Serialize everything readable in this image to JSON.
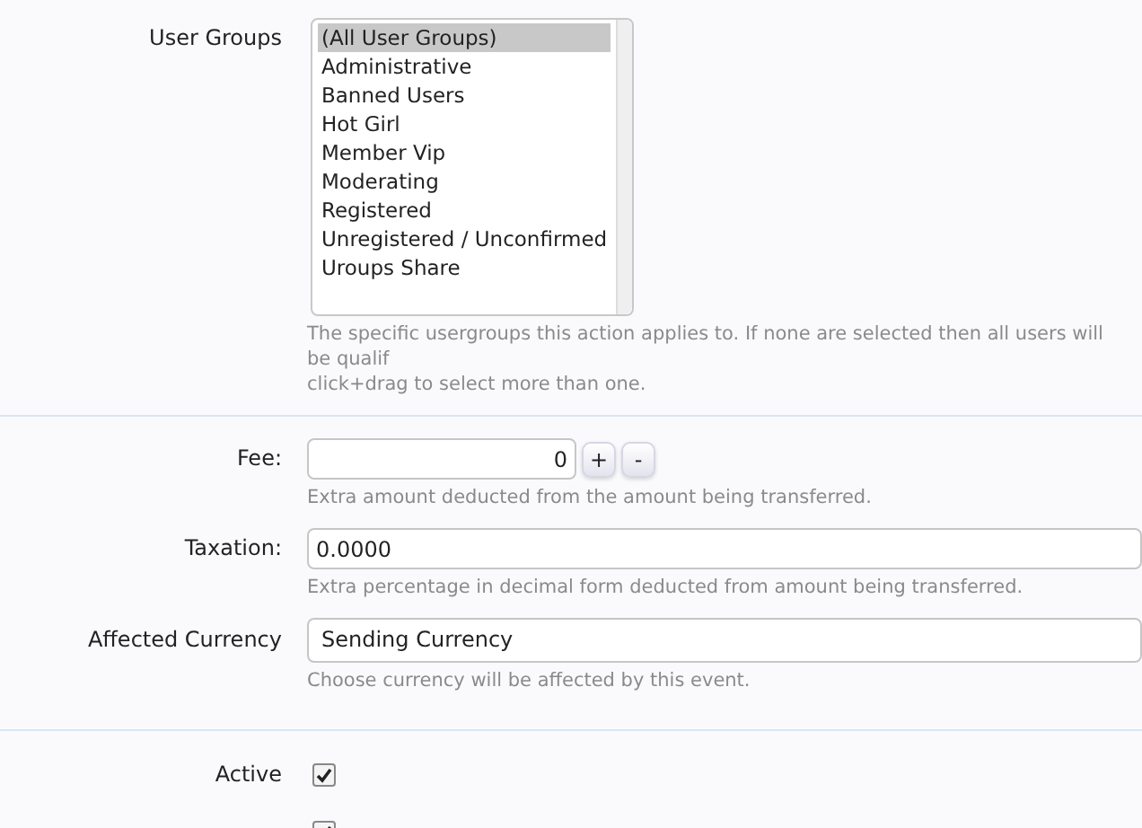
{
  "user_groups": {
    "label": "User Groups",
    "options": [
      {
        "label": "(All User Groups)",
        "selected": true
      },
      {
        "label": "Administrative",
        "selected": false
      },
      {
        "label": "Banned Users",
        "selected": false
      },
      {
        "label": "Hot Girl",
        "selected": false
      },
      {
        "label": "Member Vip",
        "selected": false
      },
      {
        "label": "Moderating",
        "selected": false
      },
      {
        "label": "Registered",
        "selected": false
      },
      {
        "label": "Unregistered / Unconfirmed",
        "selected": false
      },
      {
        "label": "Uroups Share",
        "selected": false
      }
    ],
    "hint_lines": [
      "The specific usergroups this action applies to. If none are selected then all users will be qualif",
      "click+drag to select more than one."
    ]
  },
  "fee": {
    "label": "Fee:",
    "value": "0",
    "buttons": [
      "+",
      "-"
    ],
    "hint": "Extra amount deducted from the amount being transferred."
  },
  "taxation": {
    "label": "Taxation:",
    "value": "0.0000",
    "hint": "Extra percentage in decimal form deducted from amount being transferred."
  },
  "affected_currency": {
    "label": "Affected Currency",
    "value": "Sending Currency",
    "hint": "Choose currency will be affected by this event."
  },
  "options": [
    {
      "label": "Active",
      "checked": true
    },
    {
      "checked": true
    }
  ]
}
